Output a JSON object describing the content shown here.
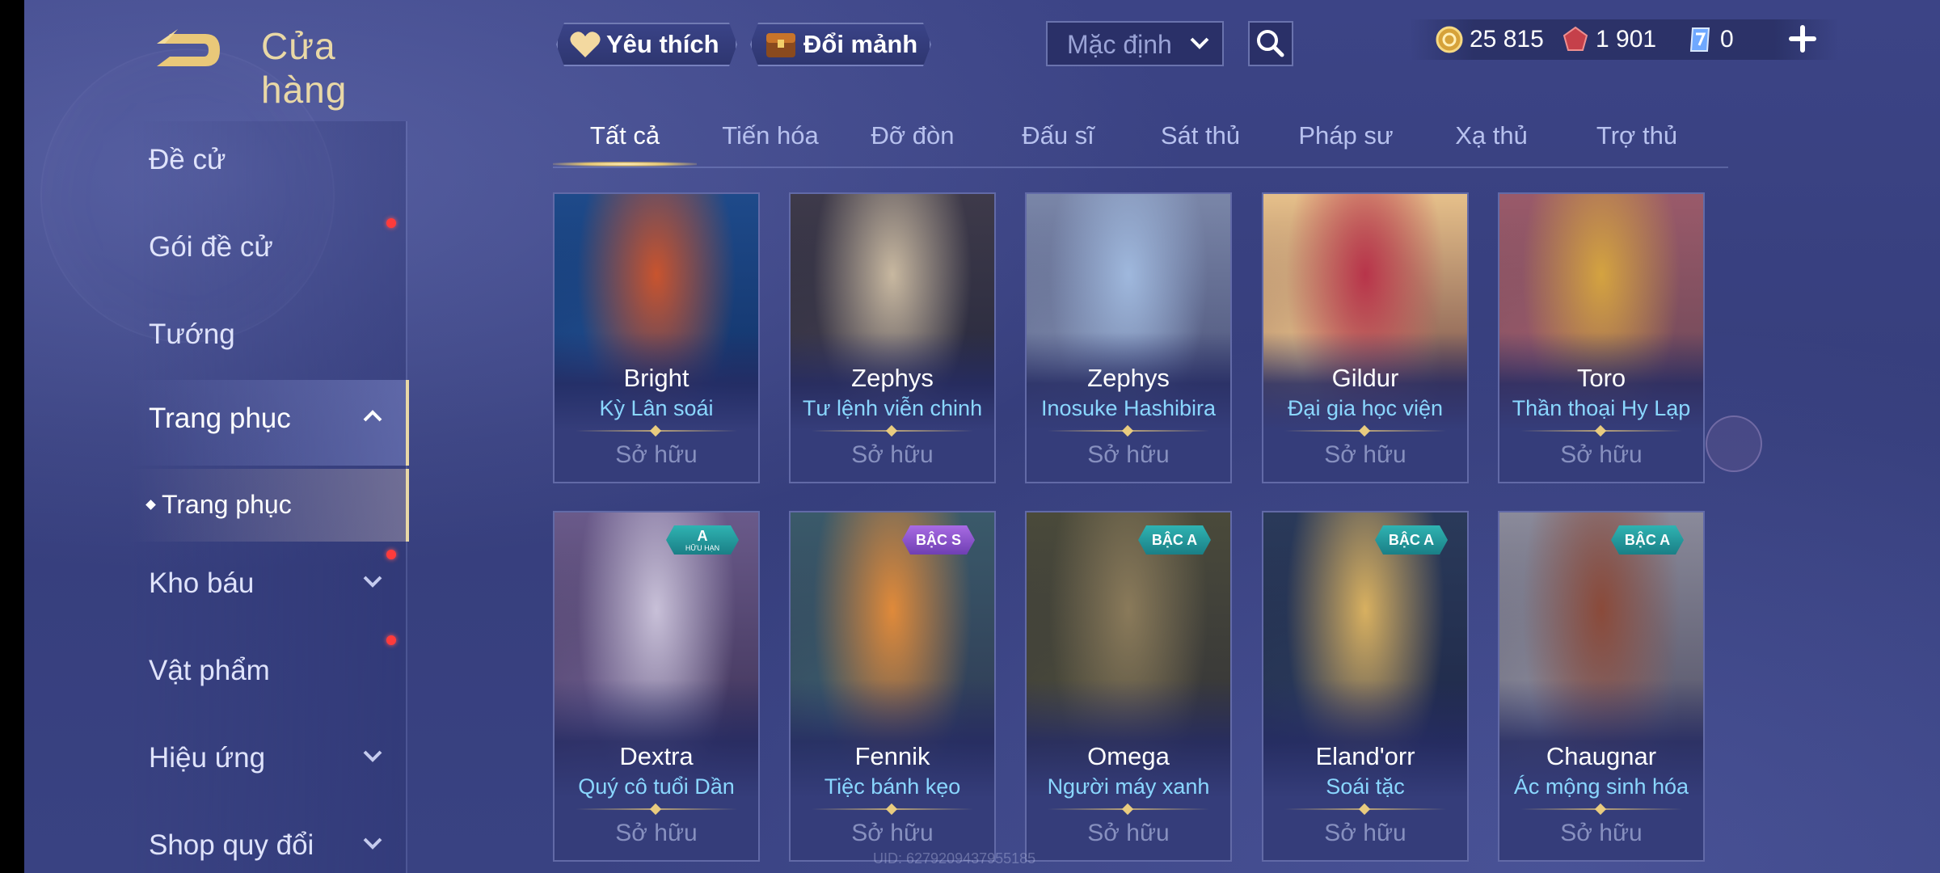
{
  "header": {
    "title": "Cửa hàng",
    "favorite_label": "Yêu thích",
    "fragment_label": "Đổi mảnh",
    "sort_label": "Mặc định"
  },
  "currency": {
    "gold": "25 815",
    "ruby": "1 901",
    "voucher": "0"
  },
  "sidebar": {
    "items": [
      {
        "label": "Đề cử"
      },
      {
        "label": "Gói đề cử"
      },
      {
        "label": "Tướng"
      },
      {
        "label": "Trang phục"
      },
      {
        "label": "Kho báu"
      },
      {
        "label": "Vật phẩm"
      },
      {
        "label": "Hiệu ứng"
      },
      {
        "label": "Shop quy đổi"
      }
    ],
    "sub_item": "Trang phục"
  },
  "tabs": [
    {
      "label": "Tất cả"
    },
    {
      "label": "Tiến hóa"
    },
    {
      "label": "Đỡ đòn"
    },
    {
      "label": "Đấu sĩ"
    },
    {
      "label": "Sát thủ"
    },
    {
      "label": "Pháp sư"
    },
    {
      "label": "Xạ thủ"
    },
    {
      "label": "Trợ thủ"
    }
  ],
  "cards": [
    {
      "hero": "Bright",
      "skin": "Kỳ Lân soái",
      "status": "Sở hữu",
      "colors": [
        "#c9542e",
        "#1e4a8a",
        "#0e2a5c"
      ]
    },
    {
      "hero": "Zephys",
      "skin": "Tư lệnh viễn chinh",
      "status": "Sở hữu",
      "colors": [
        "#c8b8a0",
        "#3e3a4a",
        "#1e2238"
      ]
    },
    {
      "hero": "Zephys",
      "skin": "Inosuke Hashibira",
      "status": "Sở hữu",
      "colors": [
        "#9fb8dd",
        "#7a86a8",
        "#3a3f68"
      ]
    },
    {
      "hero": "Gildur",
      "skin": "Đại gia học viện",
      "status": "Sở hữu",
      "colors": [
        "#b8344a",
        "#e6c08a",
        "#4a2030"
      ]
    },
    {
      "hero": "Toro",
      "skin": "Thần thoại Hy Lạp",
      "status": "Sở hữu",
      "colors": [
        "#d4a340",
        "#9a5a6a",
        "#5a4050"
      ]
    },
    {
      "hero": "Dextra",
      "skin": "Quý cô tuổi Dần",
      "status": "Sở hữu",
      "badge": "A",
      "badge_small": "HỮU HẠN",
      "badge_type": "tier-a",
      "colors": [
        "#c8c0d8",
        "#6a5a8a",
        "#2a2040"
      ]
    },
    {
      "hero": "Fennik",
      "skin": "Tiệc bánh kẹo",
      "status": "Sở hữu",
      "badge": "BẬC S",
      "badge_type": "tier-s",
      "colors": [
        "#e08a3a",
        "#3a5a6a",
        "#2a2a4a"
      ]
    },
    {
      "hero": "Omega",
      "skin": "Người máy xanh",
      "status": "Sở hữu",
      "badge": "BẬC A",
      "badge_type": "tier-a",
      "colors": [
        "#8a7a5a",
        "#4a4a3a",
        "#2a2a38"
      ]
    },
    {
      "hero": "Eland'orr",
      "skin": "Soái tặc",
      "status": "Sở hữu",
      "badge": "BẬC A",
      "badge_type": "tier-a",
      "colors": [
        "#d8b060",
        "#2a3a5a",
        "#1a2040"
      ]
    },
    {
      "hero": "Chaugnar",
      "skin": "Ác mộng sinh hóa",
      "status": "Sở hữu",
      "badge": "BẬC A",
      "badge_type": "tier-a",
      "colors": [
        "#8a4a3a",
        "#8a8a9a",
        "#3a3850"
      ]
    }
  ],
  "uid": "UID: 6279209437955185"
}
